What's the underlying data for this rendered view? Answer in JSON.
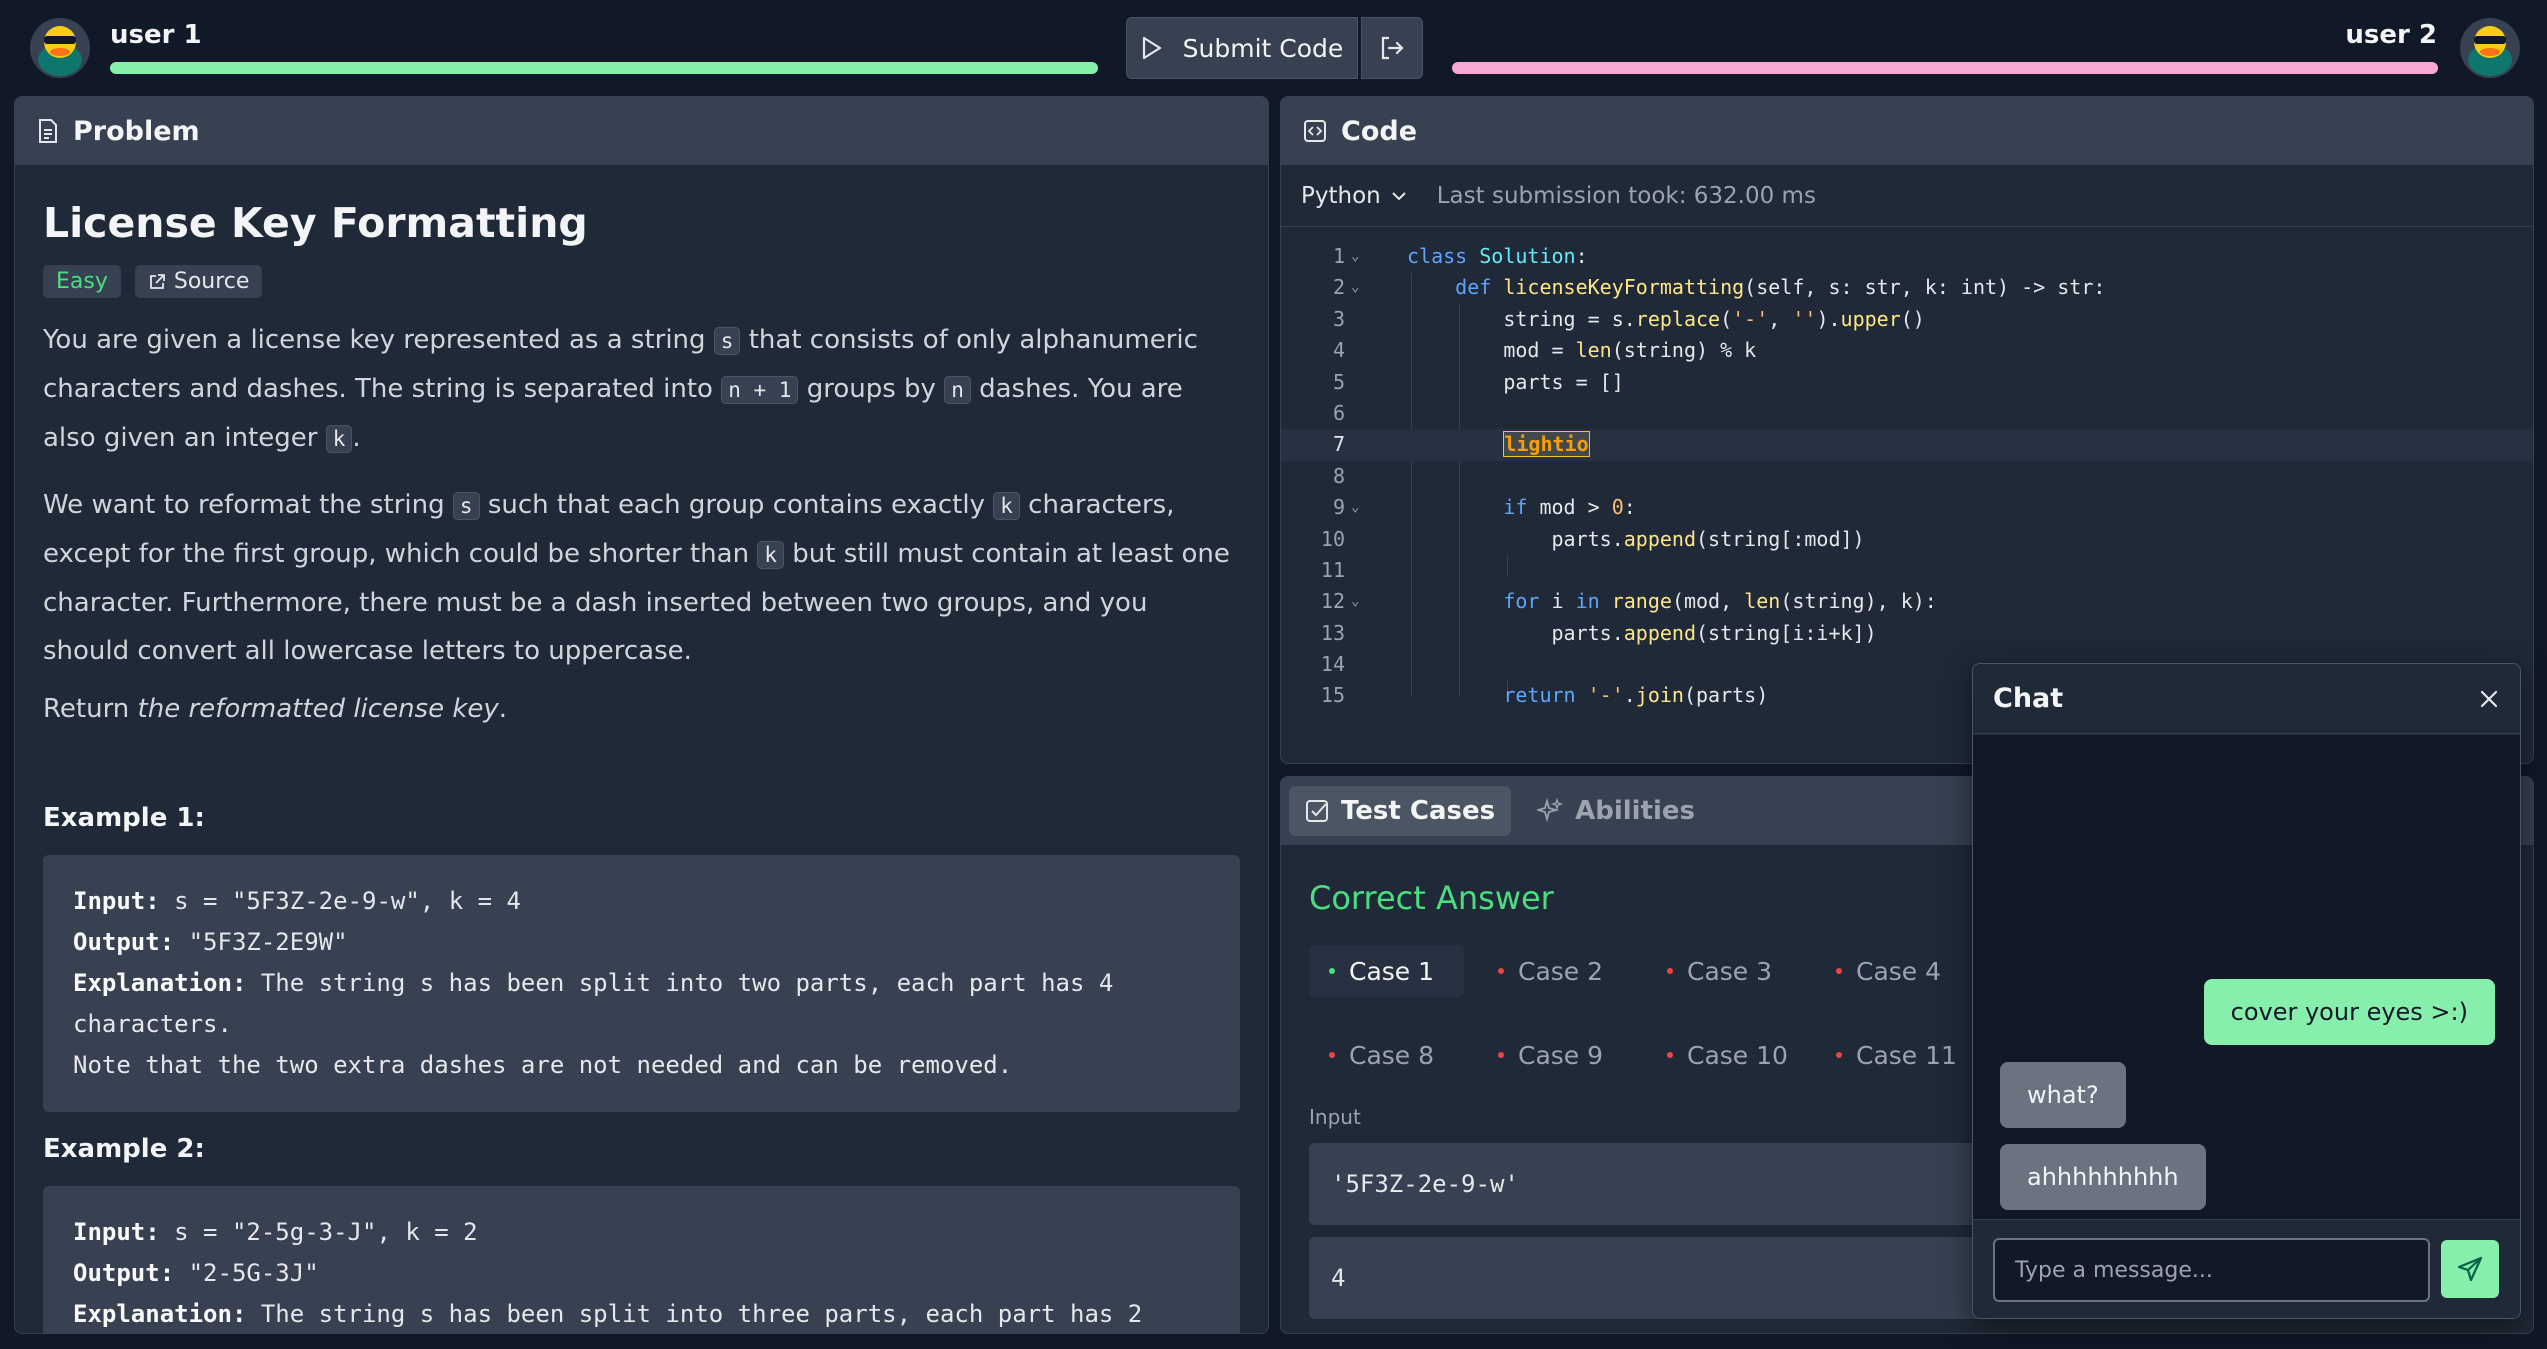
{
  "topbar": {
    "player1": {
      "name": "user 1",
      "hp_percent": 100,
      "color": "#86efac"
    },
    "player2": {
      "name": "user 2",
      "hp_percent": 100,
      "color": "#f9a8d4"
    },
    "submit_label": "Submit Code"
  },
  "problem": {
    "header": "Problem",
    "title": "License Key Formatting",
    "difficulty": "Easy",
    "source_label": "Source",
    "p1": {
      "a": "You are given a license key represented as a string ",
      "c1": "s",
      "b": " that consists of only alphanumeric characters and dashes. The string is separated into ",
      "c2": "n + 1",
      "c": " groups by ",
      "c3": "n",
      "d": " dashes. You are also given an integer ",
      "c4": "k",
      "e": "."
    },
    "p2": {
      "a": "We want to reformat the string ",
      "c1": "s",
      "b": " such that each group contains exactly ",
      "c2": "k",
      "c": " characters, except for the first group, which could be shorter than ",
      "c3": "k",
      "d": " but still must contain at least one character. Furthermore, there must be a dash inserted between two groups, and you should convert all lowercase letters to uppercase."
    },
    "p3": {
      "a": "Return ",
      "em": "the reformatted license key",
      "b": "."
    },
    "example1": {
      "title": "Example 1:",
      "input_label": "Input:",
      "input": " s = \"5F3Z-2e-9-w\", k = 4",
      "output_label": "Output:",
      "output": " \"5F3Z-2E9W\"",
      "explanation_label": "Explanation:",
      "explanation": " The string s has been split into two parts, each part has 4 characters.",
      "note": "Note that the two extra dashes are not needed and can be removed."
    },
    "example2": {
      "title": "Example 2:",
      "input_label": "Input:",
      "input": " s = \"2-5g-3-J\", k = 2",
      "output_label": "Output:",
      "output": " \"2-5G-3J\"",
      "explanation_label": "Explanation:",
      "explanation": " The string s has been split into three parts, each part has 2"
    }
  },
  "code": {
    "header": "Code",
    "language": "Python",
    "last_submission": "Last submission took: 632.00 ms",
    "lines": [
      "1",
      "2",
      "3",
      "4",
      "5",
      "6",
      "7",
      "8",
      "9",
      "10",
      "11",
      "12",
      "13",
      "14",
      "15"
    ]
  },
  "tests": {
    "tab_tests": "Test Cases",
    "tab_abilities": "Abilities",
    "verdict": "Correct Answer",
    "cases": [
      "Case 1",
      "Case 2",
      "Case 3",
      "Case 4",
      "Case 8",
      "Case 9",
      "Case 10",
      "Case 11"
    ],
    "input_label": "Input",
    "inputs": [
      "'5F3Z-2e-9-w'",
      "4"
    ]
  },
  "chat": {
    "title": "Chat",
    "messages": [
      {
        "from": "me",
        "text": "cover your eyes >:)"
      },
      {
        "from": "them",
        "text": "what?"
      },
      {
        "from": "them",
        "text": "ahhhhhhhhh"
      }
    ],
    "placeholder": "Type a message..."
  }
}
